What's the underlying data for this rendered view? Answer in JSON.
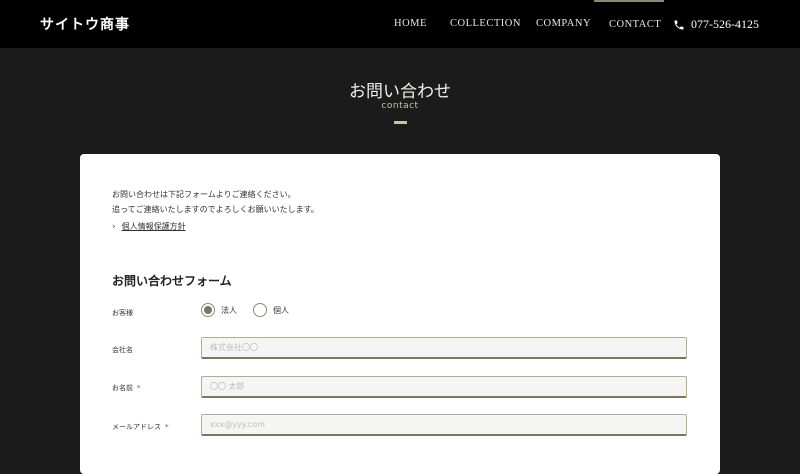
{
  "header": {
    "logo": "サイトウ商事",
    "nav": [
      {
        "label": "HOME"
      },
      {
        "label": "COLLECTION"
      },
      {
        "label": "COMPANY"
      },
      {
        "label": "CONTACT",
        "active": true
      }
    ],
    "phone": "077-526-4125",
    "phone_icon": "phone-icon"
  },
  "hero": {
    "title": "お問い合わせ",
    "subtitle": "contact"
  },
  "card": {
    "intro_line1": "お問い合わせは下記フォームよりご連絡ください。",
    "intro_line2": "追ってご連絡いたしますのでよろしくお願いいたします。",
    "privacy_link": "個人情報保護方針",
    "form_title": "お問い合わせフォーム",
    "fields": {
      "customer": {
        "label": "お客様",
        "options": [
          "法人",
          "個人"
        ],
        "selected": "法人"
      },
      "company": {
        "label": "会社名",
        "placeholder": "株式会社〇〇",
        "value": ""
      },
      "name": {
        "label": "お名前",
        "required_mark": "*",
        "placeholder": "〇〇 太郎",
        "value": ""
      },
      "email": {
        "label": "メールアドレス",
        "required_mark": "*",
        "placeholder": "xxx@yyy.com",
        "value": ""
      }
    }
  },
  "colors": {
    "accent": "#7a7660",
    "header_bg": "#000000",
    "page_bg": "#1b1b1b",
    "hero_sub": "#c8c3a2"
  }
}
